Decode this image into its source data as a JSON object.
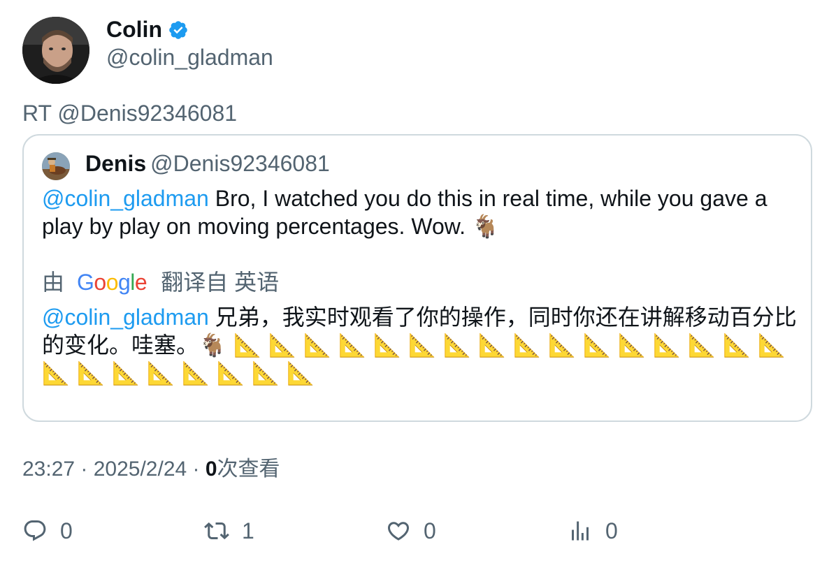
{
  "author": {
    "name": "Colin",
    "handle": "@colin_gladman",
    "verified": true
  },
  "rt_line": "RT @Denis92346081",
  "quote": {
    "name": "Denis",
    "handle": "@Denis92346081",
    "mention": "@colin_gladman",
    "text": " Bro, I watched you do this in real time, while you gave a play by play on moving percentages. Wow. ",
    "goat_emoji": "🐐",
    "translation": {
      "prefix": "由",
      "google": [
        "G",
        "o",
        "o",
        "g",
        "l",
        "e"
      ],
      "suffix": "翻译自 英语",
      "mention": "@colin_gladman",
      "text": " 兄弟，我实时观看了你的操作，同时你还在讲解移动百分比的变化。哇塞。",
      "goat_emoji": "🐐",
      "ruler_emojis": " 📐 📐 📐 📐 📐 📐 📐 📐 📐 📐 📐 📐 📐 📐 📐 📐 📐 📐 📐 📐 📐 📐 📐 📐"
    }
  },
  "meta": {
    "time": "23:27 · 2025/2/24 · ",
    "views_count": "0",
    "views_label": "次查看"
  },
  "actions": {
    "replies": "0",
    "retweets": "1",
    "likes": "0",
    "views": "0"
  },
  "colors": {
    "mention": "#1d9bf0",
    "secondary_text": "#536471",
    "verified": "#1d9bf0",
    "border": "#cfd9de"
  }
}
